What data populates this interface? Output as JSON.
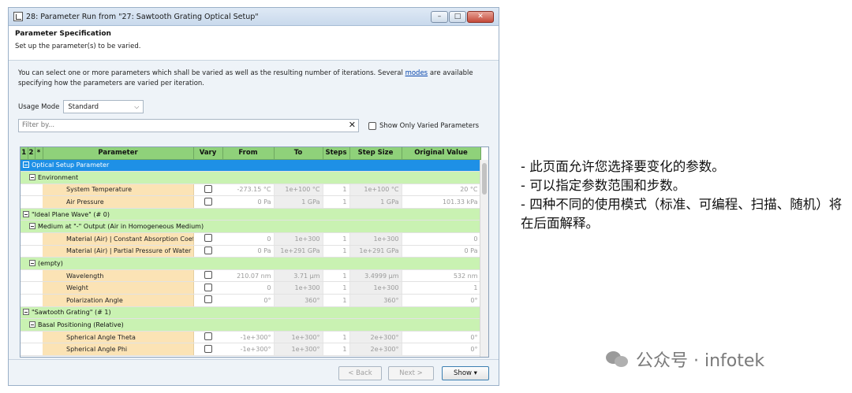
{
  "window": {
    "title": "28: Parameter Run from \"27: Sawtooth Grating Optical Setup\"",
    "minimize": "–",
    "maximize": "□",
    "close": "✕"
  },
  "header": {
    "title": "Parameter Specification",
    "subtitle": "Set up the parameter(s) to be varied."
  },
  "description": {
    "before": "You can select one or more parameters which shall be varied as well as the resulting number of iterations. Several ",
    "link": "modes",
    "after": " are available specifying how the parameters are varied per iteration."
  },
  "usage_mode": {
    "label": "Usage Mode",
    "value": "Standard"
  },
  "filter": {
    "placeholder": "Filter by...",
    "clear": "✕",
    "show_only_label": "Show Only Varied Parameters"
  },
  "grid": {
    "headers": {
      "c1": "1",
      "c2": "2",
      "c3": "*",
      "parameter": "Parameter",
      "vary": "Vary",
      "from": "From",
      "to": "To",
      "steps": "Steps",
      "step_size": "Step Size",
      "original": "Original Value"
    },
    "rows": [
      {
        "kind": "sel",
        "label": "Optical Setup Parameter"
      },
      {
        "kind": "group",
        "label": "Environment"
      },
      {
        "kind": "param",
        "label": "System Temperature",
        "from": "-273.15 °C",
        "to": "1e+100 °C",
        "steps": "1",
        "step": "1e+100 °C",
        "orig": "20 °C"
      },
      {
        "kind": "param",
        "label": "Air Pressure",
        "from": "0 Pa",
        "to": "1 GPa",
        "steps": "1",
        "step": "1 GPa",
        "orig": "101.33 kPa"
      },
      {
        "kind": "group",
        "label": "\"Ideal Plane Wave\" (# 0)"
      },
      {
        "kind": "group",
        "label": "Medium at \"-\" Output (Air in Homogeneous Medium)"
      },
      {
        "kind": "param",
        "label": "Material (Air) | Constant Absorption Coeffi...",
        "from": "0",
        "to": "1e+300",
        "steps": "1",
        "step": "1e+300",
        "orig": "0"
      },
      {
        "kind": "param",
        "label": "Material (Air) | Partial Pressure of Water Va...",
        "from": "0 Pa",
        "to": "1e+291 GPa",
        "steps": "1",
        "step": "1e+291 GPa",
        "orig": "0 Pa"
      },
      {
        "kind": "group",
        "label": "(empty)"
      },
      {
        "kind": "param",
        "label": "Wavelength",
        "from": "210.07 nm",
        "to": "3.71 µm",
        "steps": "1",
        "step": "3.4999 µm",
        "orig": "532 nm"
      },
      {
        "kind": "param",
        "label": "Weight",
        "from": "0",
        "to": "1e+300",
        "steps": "1",
        "step": "1e+300",
        "orig": "1"
      },
      {
        "kind": "param",
        "label": "Polarization Angle",
        "from": "0°",
        "to": "360°",
        "steps": "1",
        "step": "360°",
        "orig": "0°"
      },
      {
        "kind": "group",
        "label": "\"Sawtooth Grating\" (# 1)"
      },
      {
        "kind": "group",
        "label": "Basal Positioning (Relative)"
      },
      {
        "kind": "param",
        "label": "Spherical Angle Theta",
        "from": "-1e+300°",
        "to": "1e+300°",
        "steps": "1",
        "step": "2e+300°",
        "orig": "0°"
      },
      {
        "kind": "param",
        "label": "Spherical Angle Phi",
        "from": "-1e+300°",
        "to": "1e+300°",
        "steps": "1",
        "step": "2e+300°",
        "orig": "0°"
      }
    ]
  },
  "footer": {
    "back": "< Back",
    "next": "Next >",
    "show": "Show ▾"
  },
  "notes": [
    "- 此页面允许您选择要变化的参数。",
    "- 可以指定参数范围和步数。",
    "- 四种不同的使用模式（标准、可编程、扫描、随机）将在后面解释。"
  ],
  "watermark": "公众号 · infotek"
}
